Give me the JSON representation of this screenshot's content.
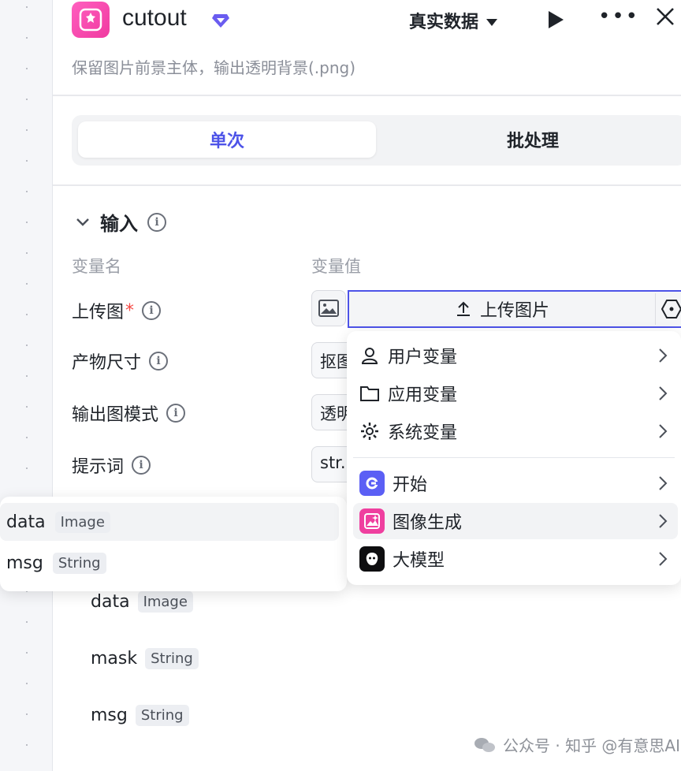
{
  "header": {
    "title": "cutout",
    "mode_label": "真实数据",
    "description": "保留图片前景主体，输出透明背景(.png)"
  },
  "tabs": [
    {
      "label": "单次",
      "active": true
    },
    {
      "label": "批处理",
      "active": false
    }
  ],
  "input_section": {
    "title": "输入",
    "col_name": "变量名",
    "col_value": "变量值",
    "rows": [
      {
        "label": "上传图",
        "required_mark": "*",
        "upload_label": "上传图片"
      },
      {
        "label": "产物尺寸",
        "value": "抠图"
      },
      {
        "label": "输出图模式",
        "value": "透明"
      },
      {
        "label": "提示词",
        "value": "str."
      }
    ]
  },
  "output_items": [
    {
      "name": "data",
      "type": "Image"
    },
    {
      "name": "mask",
      "type": "String"
    },
    {
      "name": "msg",
      "type": "String"
    }
  ],
  "variable_popup": {
    "items": [
      {
        "name": "data",
        "type": "Image"
      },
      {
        "name": "msg",
        "type": "String"
      }
    ]
  },
  "source_menu": {
    "groups": [
      {
        "label": "用户变量",
        "icon": "user-icon"
      },
      {
        "label": "应用变量",
        "icon": "folder-icon"
      },
      {
        "label": "系统变量",
        "icon": "gear-icon"
      }
    ],
    "nodes": [
      {
        "label": "开始",
        "icon": "start-node-icon",
        "color": "#5b5ff5"
      },
      {
        "label": "图像生成",
        "icon": "image-gen-node-icon",
        "color": "#ef3f9f"
      },
      {
        "label": "大模型",
        "icon": "llm-node-icon",
        "color": "#0e0e10"
      }
    ]
  },
  "colors": {
    "accent": "#4d53e8",
    "required": "#f54a45"
  },
  "watermark": "公众号 · 知乎 @有意思AI"
}
